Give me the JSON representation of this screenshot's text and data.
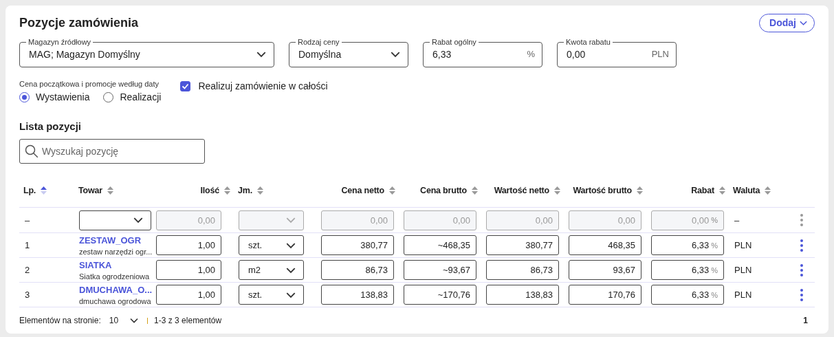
{
  "title": "Pozycje zamówienia",
  "add_button": {
    "label": "Dodaj"
  },
  "fields": [
    {
      "kind": "select",
      "label": "Magazyn źródłowy",
      "value": "MAG; Magazyn Domyślny"
    },
    {
      "kind": "select",
      "label": "Rodzaj ceny",
      "value": "Domyślna"
    },
    {
      "kind": "input",
      "label": "Rabat ogólny",
      "value": "6,33",
      "unit": "%"
    },
    {
      "kind": "input",
      "label": "Kwota rabatu",
      "value": "0,00",
      "unit": "PLN"
    }
  ],
  "date_basis": {
    "label": "Cena początkowa i promocje według daty",
    "options": [
      {
        "label": "Wystawienia",
        "selected": true
      },
      {
        "label": "Realizacji",
        "selected": false
      }
    ]
  },
  "full_order": {
    "label": "Realizuj zamówienie w całości",
    "checked": true
  },
  "list_title": "Lista pozycji",
  "search": {
    "placeholder": "Wyszukaj pozycję"
  },
  "table": {
    "columns": [
      {
        "label": "Lp.",
        "sorted": true,
        "kind": "text"
      },
      {
        "label": "Towar",
        "sorted": false,
        "kind": "text"
      },
      {
        "label": "Ilość",
        "sorted": false,
        "kind": "number"
      },
      {
        "label": "Jm.",
        "sorted": false,
        "kind": "text"
      },
      {
        "label": "Cena netto",
        "sorted": false,
        "kind": "number"
      },
      {
        "label": "Cena brutto",
        "sorted": false,
        "kind": "number"
      },
      {
        "label": "Wartość netto",
        "sorted": false,
        "kind": "number"
      },
      {
        "label": "Wartość brutto",
        "sorted": false,
        "kind": "number"
      },
      {
        "label": "Rabat",
        "sorted": false,
        "kind": "number"
      },
      {
        "label": "Waluta",
        "sorted": false,
        "kind": "text"
      }
    ],
    "filter_row": {
      "lp": "–",
      "quantity": "0,00",
      "net_price": "0,00",
      "gross_price": "0,00",
      "net_value": "0,00",
      "gross_value": "0,00",
      "discount": "0,00",
      "discount_unit": "%",
      "currency": "–",
      "disabled": true
    },
    "rows": [
      {
        "lp": "1",
        "code": "ZESTAW_OGR",
        "name": "zestaw narzędzi ogr...",
        "quantity": "1,00",
        "unit": "szt.",
        "net_price": "380,77",
        "gross_price": "~468,35",
        "net_value": "380,77",
        "gross_value": "468,35",
        "discount": "6,33",
        "discount_unit": "%",
        "currency": "PLN",
        "disabled": false
      },
      {
        "lp": "2",
        "code": "SIATKA",
        "name": "Siatka ogrodzeniowa",
        "quantity": "1,00",
        "unit": "m2",
        "net_price": "86,73",
        "gross_price": "~93,67",
        "net_value": "86,73",
        "gross_value": "93,67",
        "discount": "6,33",
        "discount_unit": "%",
        "currency": "PLN",
        "disabled": false
      },
      {
        "lp": "3",
        "code": "DMUCHAWA_O...",
        "name": "dmuchawa ogrodowa",
        "quantity": "1,00",
        "unit": "szt.",
        "net_price": "138,83",
        "gross_price": "~170,76",
        "net_value": "138,83",
        "gross_value": "170,76",
        "discount": "6,33",
        "discount_unit": "%",
        "currency": "PLN",
        "disabled": false
      }
    ]
  },
  "footer": {
    "per_page_label": "Elementów na stronie:",
    "per_page": "10",
    "range": "1-3 z 3 elementów",
    "page": "1"
  }
}
